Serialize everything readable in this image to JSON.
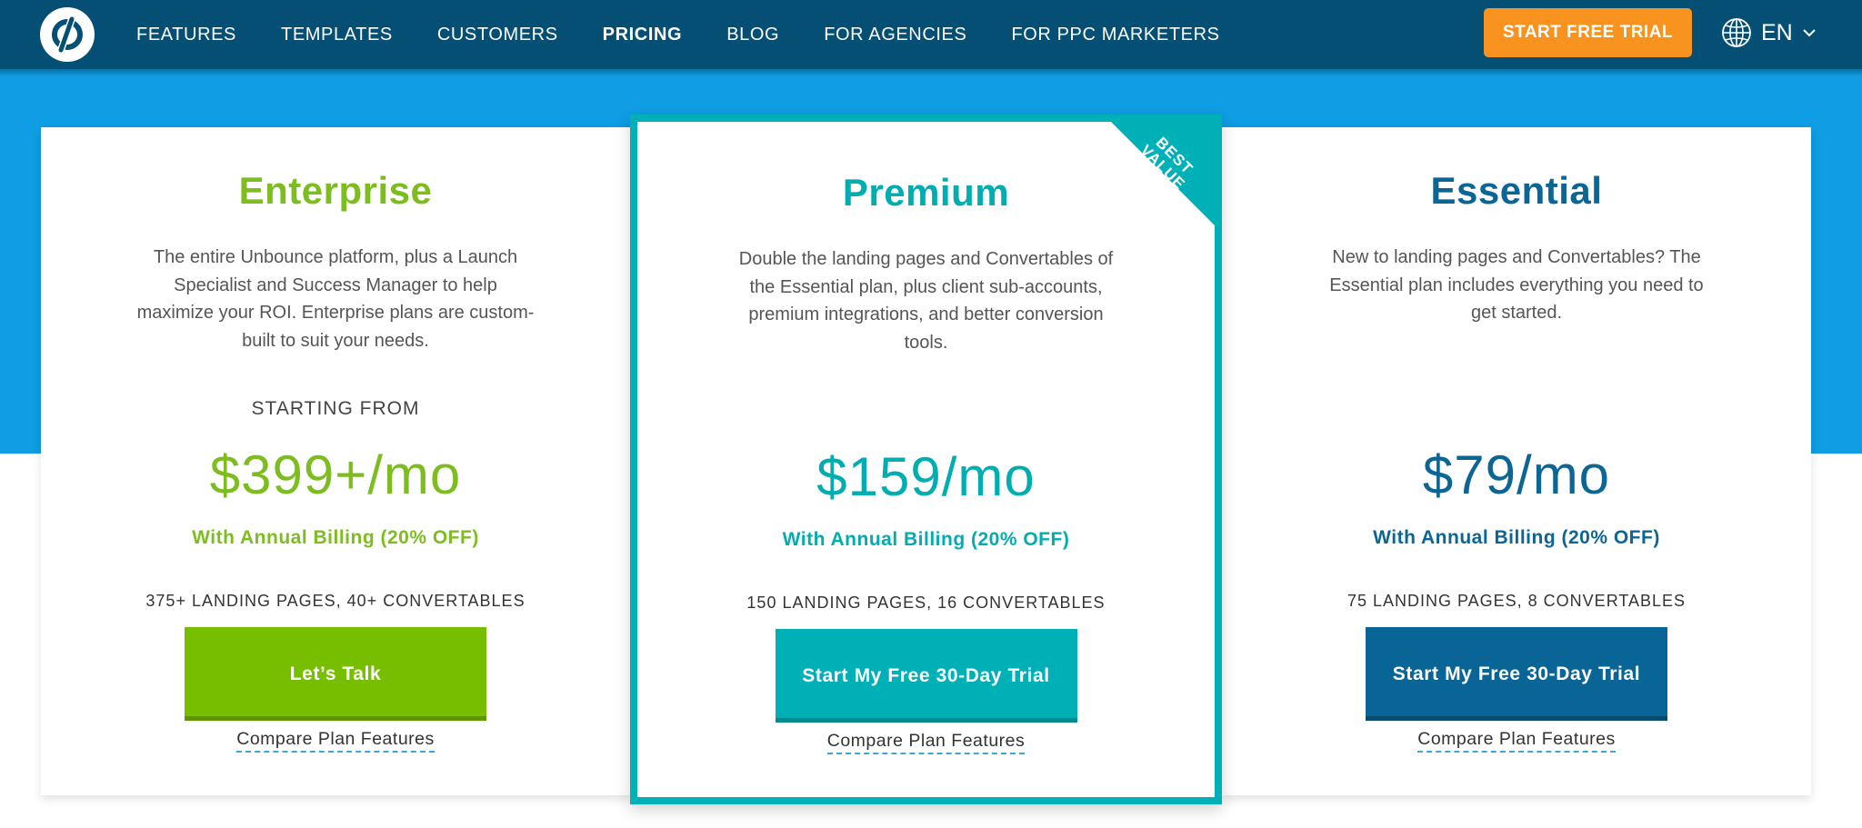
{
  "nav": {
    "items": [
      {
        "label": "FEATURES"
      },
      {
        "label": "TEMPLATES"
      },
      {
        "label": "CUSTOMERS"
      },
      {
        "label": "PRICING",
        "active": true
      },
      {
        "label": "BLOG"
      },
      {
        "label": "FOR AGENCIES"
      },
      {
        "label": "FOR PPC MARKETERS"
      }
    ],
    "cta_label": "START FREE TRIAL",
    "language": "EN",
    "icons": {
      "logo": "unbounce-logo",
      "language": "globe-icon",
      "dropdown": "chevron-down-icon"
    }
  },
  "plans": [
    {
      "name": "Enterprise",
      "description": "The entire Unbounce platform, plus a Launch Specialist and Success Manager to help maximize your ROI. Enterprise plans are custom-built to suit your needs.",
      "starting_label": "STARTING FROM",
      "price": "$399+/mo",
      "billing": "With Annual Billing (20% OFF)",
      "limits": "375+ LANDING PAGES, 40+ CONVERTABLES",
      "button_label": "Let’s Talk",
      "compare_label": "Compare Plan Features",
      "color": "#7dbd1f"
    },
    {
      "name": "Premium",
      "badge": "BEST VALUE",
      "description": "Double the landing pages and Convertables of the Essential plan, plus client sub-accounts, premium integrations, and better conversion tools.",
      "price": "$159/mo",
      "billing": "With Annual Billing (20% OFF)",
      "limits": "150 LANDING PAGES, 16 CONVERTABLES",
      "button_label": "Start My Free 30-Day Trial",
      "compare_label": "Compare Plan Features",
      "color": "#00adb1"
    },
    {
      "name": "Essential",
      "description": "New to landing pages and Convertables? The Essential plan includes everything you need to get started.",
      "price": "$79/mo",
      "billing": "With Annual Billing (20% OFF)",
      "limits": "75 LANDING PAGES, 8 CONVERTABLES",
      "button_label": "Start My Free 30-Day Trial",
      "compare_label": "Compare Plan Features",
      "color": "#0b6595"
    }
  ],
  "colors": {
    "nav_bg": "#064f74",
    "band_bg": "#0f9de3",
    "cta_bg": "#f7931e"
  }
}
